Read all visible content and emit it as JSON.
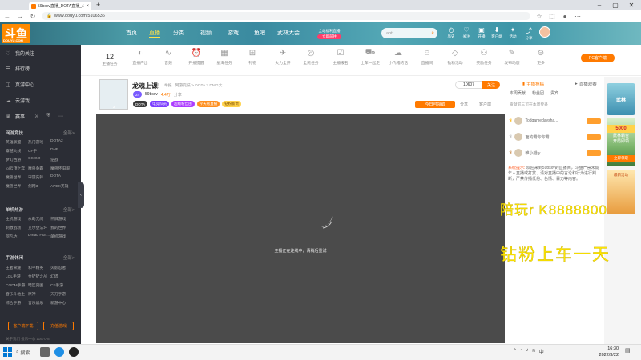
{
  "browser": {
    "tab_title": "59bsxv直播_DOTA直播_斗鱼直",
    "url": "www.douyu.com/5106536"
  },
  "header": {
    "logo": "斗鱼",
    "logo_sub": "DOUYU.COM",
    "nav": [
      "首页",
      "直播",
      "分类",
      "视频",
      "游戏",
      "鱼吧",
      "武林大会"
    ],
    "active_nav": "直播",
    "promo": "全站福利直播",
    "promo_btn": "立即前往",
    "search_placeholder": "abtt",
    "top_icons": [
      "历史",
      "关注",
      "开播",
      "客户端",
      "活动",
      "分享"
    ]
  },
  "sidebar": {
    "top_items": [
      "我的关注",
      "排行榜",
      "页游中心",
      "云游戏"
    ],
    "quick_label": "赛事",
    "sections": [
      {
        "title": "网游竞技",
        "more": "全部>",
        "items": [
          "英雄联盟",
          "热门游戏",
          "DOTA2",
          "穿越火线",
          "CF手",
          "DNF",
          "梦幻西游",
          "CS:GO",
          "逆战",
          "lol云顶之弈",
          "魔兽争霸",
          "魔兽怀旧服",
          "魔兽世界",
          "守望先锋",
          "DOTA",
          "魔兽世界",
          "剑网3",
          "APEX英雄"
        ]
      },
      {
        "title": "单机热游",
        "more": "全部>",
        "items": [
          "主机游戏",
          "永劫无间",
          "怀旧游戏",
          "刺激战场",
          "艾尔登法环",
          "我的世界",
          "阿凡达",
          "Dread Hun...",
          "单机游戏"
        ]
      },
      {
        "title": "手游休闲",
        "more": "全部>",
        "items": [
          "王者荣耀",
          "和平精英",
          "火影忍者",
          "LOL手游",
          "金铲铲之战",
          "幻塔",
          "CODM手游",
          "暗区突围",
          "CF手游",
          "音乐斗地主",
          "原神",
          "天刀手游",
          "综合手游",
          "音乐娱乐",
          "新游中心"
        ]
      }
    ],
    "btn_client": "客户端下载",
    "btn_game": "充值游戏",
    "footer": "关于我们 投诉中心 11670-8"
  },
  "iconrow": {
    "count": "12",
    "count_label": "主播任务",
    "items": [
      "直播产出",
      "音频",
      "开播提醒",
      "星海任务",
      "主播等级",
      "礼物",
      "火力全开",
      "全民任务",
      "主播报名",
      "上车一起走",
      "小飞猪的话",
      "直播间",
      "钻粉活动",
      "奖励任务",
      "发布动态",
      "更多"
    ],
    "pc_btn": "PC客户端"
  },
  "room": {
    "title": "龙魂上课!",
    "meta": [
      "举报",
      "网游竞技 > DOTA > DMG大...",
      "分享"
    ],
    "anchor": "59bsxv",
    "level": "24",
    "hot": "4.4万",
    "tags": [
      "DOTA",
      "电竞队员",
      "超级粉丝团",
      "今天看直播",
      "钻粉新贵"
    ],
    "follow_count": "10607",
    "follow_btn": "关注",
    "today_btn": "今日可领取",
    "share": "分享",
    "report": "客户端"
  },
  "video": {
    "loading_text": "主播正在连线中，请稍后重试"
  },
  "rpanel": {
    "tabs": [
      "主播投稿",
      "直播观赛"
    ],
    "subtabs": [
      "本周贡献",
      "粉丝团",
      "贵宾"
    ],
    "notice": "贡献前三可在本周登录",
    "users": [
      {
        "name": "Todgamedaysha...",
        "badge": ""
      },
      {
        "name": "面的霸你你霸",
        "badge": ""
      },
      {
        "name": "唯小腿ty",
        "badge": ""
      }
    ],
    "chat_system": "系统提示:",
    "chat_text": "欢迎来到59bsxv的直播间，斗鱼严禁未成年人直播或打赏、请对直播中的言论和行为进行判断，严禁传播低俗、色情、暴力等内容。"
  },
  "ads": {
    "top": "武林",
    "game": "武林霸台",
    "game_sub": "开局即领",
    "amount": "5000",
    "amount_btn": "立即领取",
    "ad2": "最新活动"
  },
  "overlay": {
    "line1": "陪玩r K8888800",
    "line2": "钻粉上车一天"
  },
  "taskbar": {
    "search": "搜索",
    "time": "16:30",
    "date": "2022/3/22"
  }
}
